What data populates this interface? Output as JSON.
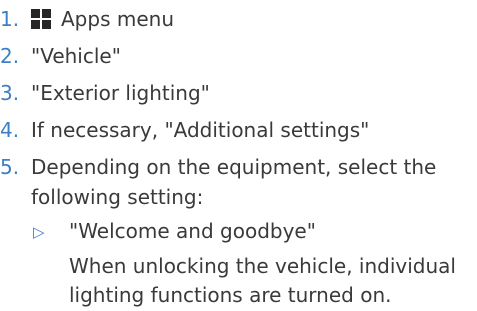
{
  "steps": [
    {
      "number": "1.",
      "text": "Apps menu",
      "icon": "apps-grid-icon"
    },
    {
      "number": "2.",
      "text": "\"Vehicle\""
    },
    {
      "number": "3.",
      "text": "\"Exterior lighting\""
    },
    {
      "number": "4.",
      "text": "If necessary, \"Additional settings\""
    },
    {
      "number": "5.",
      "text_line1": "Depending on the equipment, select the",
      "text_line2": "following setting:"
    }
  ],
  "sub_item": {
    "marker": "▷",
    "text": "\"Welcome and goodbye\"",
    "note_line1": "When unlocking the vehicle, individual",
    "note_line2": "lighting functions are turned on."
  },
  "colors": {
    "number": "#3d7fc4",
    "text": "#3a3a3a",
    "icon": "#262626"
  }
}
